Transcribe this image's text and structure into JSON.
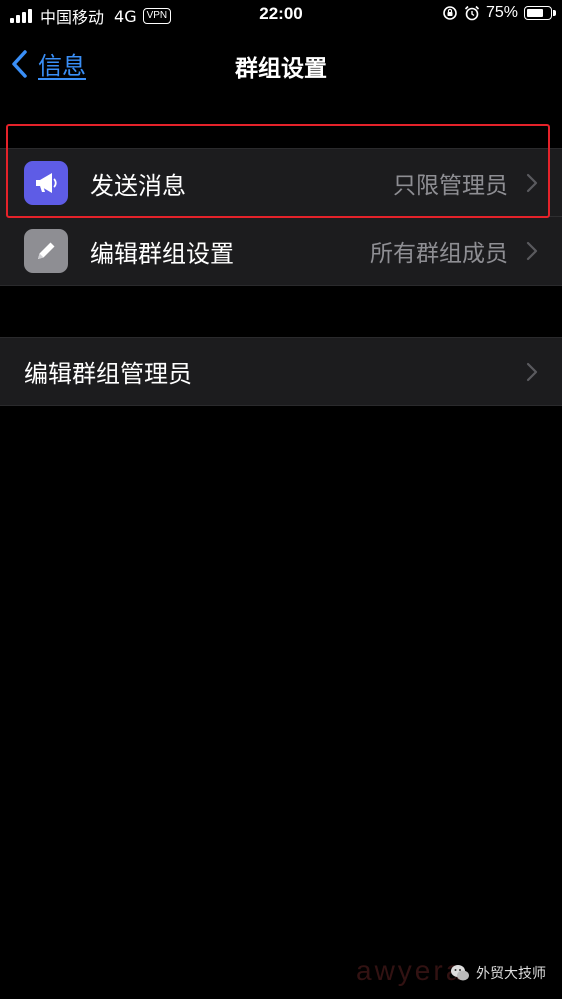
{
  "status_bar": {
    "carrier": "中国移动",
    "network": "4G",
    "vpn": "VPN",
    "time": "22:00",
    "battery_percent": "75%",
    "battery_level": 0.75,
    "signal_bars": 4
  },
  "nav": {
    "back_label": "信息",
    "title": "群组设置",
    "accent_color": "#3a8ff7"
  },
  "settings": {
    "send_messages": {
      "label": "发送消息",
      "value": "只限管理员",
      "icon": "megaphone-icon",
      "icon_color": "#5e5ce6"
    },
    "edit_group_settings": {
      "label": "编辑群组设置",
      "value": "所有群组成员",
      "icon": "pencil-icon",
      "icon_color": "#8e8e93"
    },
    "edit_group_admins": {
      "label": "编辑群组管理员"
    }
  },
  "highlight_color": "#e5222a",
  "watermark": {
    "label": "外贸大技师",
    "ghost_text": "awyera"
  }
}
